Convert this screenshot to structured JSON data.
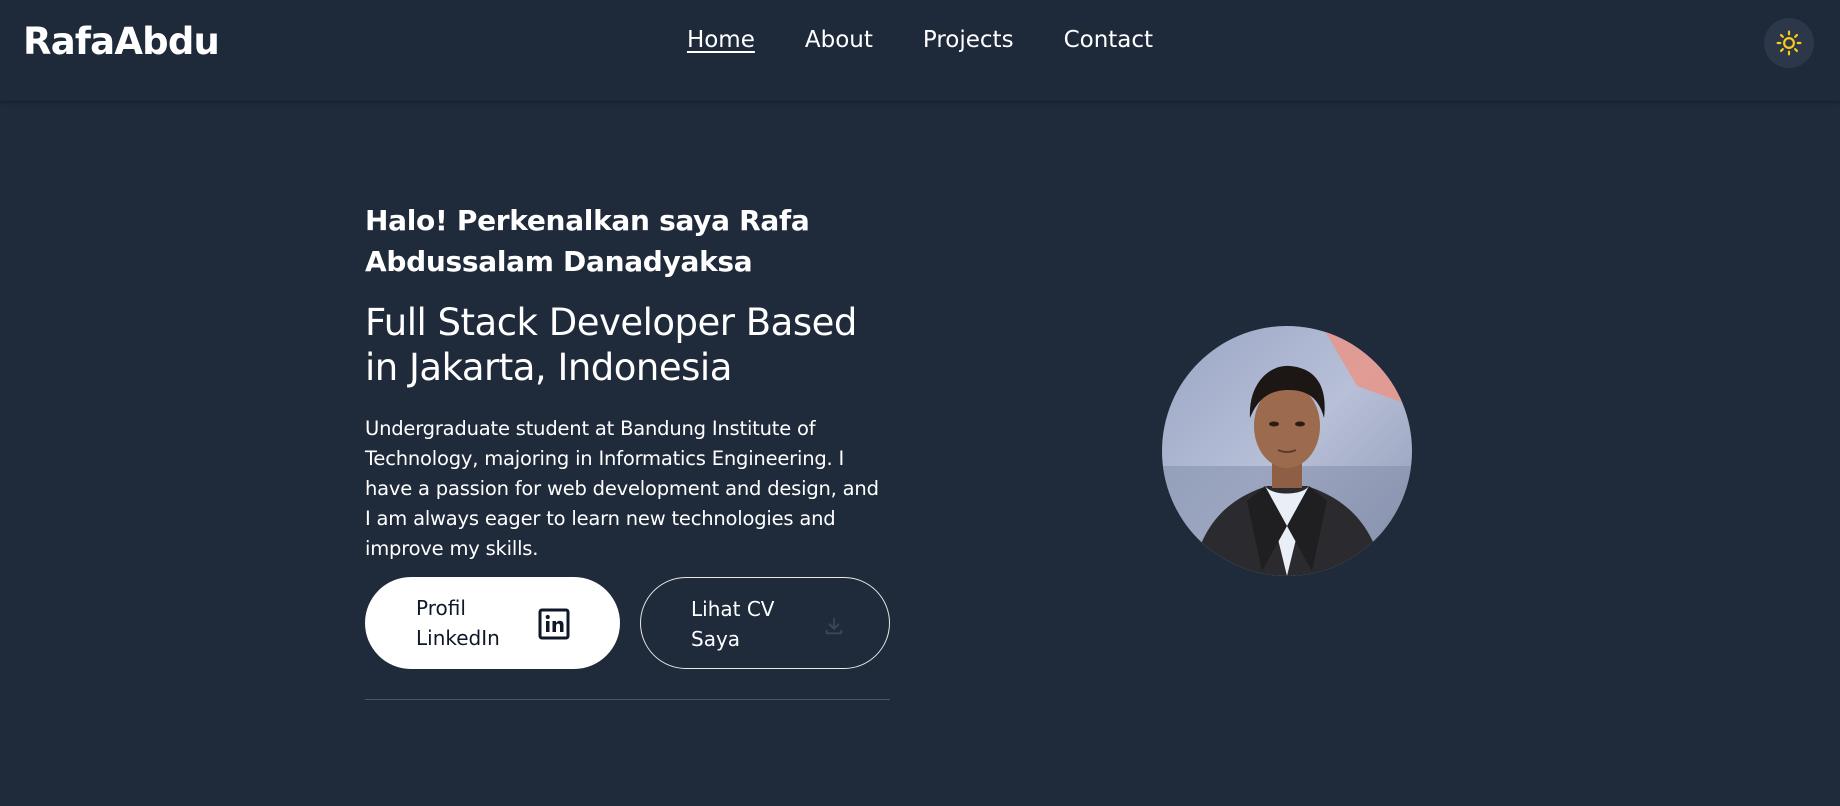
{
  "brand": {
    "logo": "RafaAbdu"
  },
  "nav": {
    "items": [
      {
        "label": "Home",
        "active": true
      },
      {
        "label": "About",
        "active": false
      },
      {
        "label": "Projects",
        "active": false
      },
      {
        "label": "Contact",
        "active": false
      }
    ],
    "theme_toggle_icon": "sun-icon",
    "theme_icon_color": "#facc15"
  },
  "hero": {
    "greeting": "Halo! Perkenalkan saya Rafa Abdussalam Danadyaksa",
    "role": "Full Stack Developer Based in Jakarta, Indonesia",
    "bio": "Undergraduate student at Bandung Institute of Technology, majoring in Informatics Engineering. I have a passion for web development and design, and I am always eager to learn new technologies and improve my skills.",
    "buttons": {
      "linkedin_label": "Profil LinkedIn",
      "linkedin_icon": "linkedin-icon",
      "cv_label": "Lihat CV Saya",
      "cv_icon": "download-icon"
    }
  },
  "colors": {
    "background": "#1f2a3b",
    "navbar": "#1e293a",
    "text": "#ffffff",
    "button_primary_bg": "#ffffff",
    "button_primary_text": "#0f172a"
  }
}
